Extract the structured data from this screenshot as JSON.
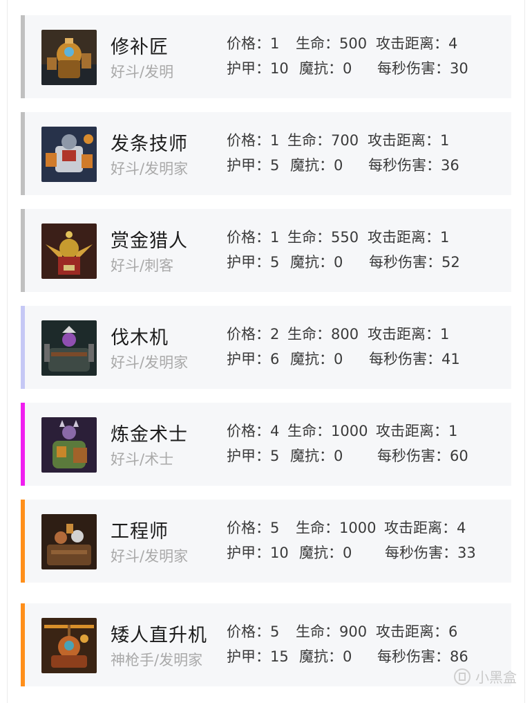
{
  "labels": {
    "price": "价格：",
    "hp": "生命：",
    "range": "攻击距离：",
    "armor": "护甲：",
    "mr": "魔抗：",
    "dps": "每秒伤害："
  },
  "units": [
    {
      "name": "修补匠",
      "traits": "好斗/发明",
      "price": "1",
      "hp": "500",
      "range": "4",
      "armor": "10",
      "mr": "0",
      "dps": "30",
      "accent": "#c0c0c0",
      "portrait": "tinker-portrait"
    },
    {
      "name": "发条技师",
      "traits": "好斗/发明家",
      "price": "1",
      "hp": "700",
      "range": "1",
      "armor": "5",
      "mr": "0",
      "dps": "36",
      "accent": "#c0c0c0",
      "portrait": "clockwerk-portrait"
    },
    {
      "name": "赏金猎人",
      "traits": "好斗/刺客",
      "price": "1",
      "hp": "550",
      "range": "1",
      "armor": "5",
      "mr": "0",
      "dps": "52",
      "accent": "#c0c0c0",
      "portrait": "bounty-hunter-portrait"
    },
    {
      "name": "伐木机",
      "traits": "好斗/发明家",
      "price": "2",
      "hp": "800",
      "range": "1",
      "armor": "6",
      "mr": "0",
      "dps": "41",
      "accent": "#c5c8f5",
      "portrait": "timbersaw-portrait"
    },
    {
      "name": "炼金术士",
      "traits": "好斗/术士",
      "price": "4",
      "hp": "1000",
      "range": "1",
      "armor": "5",
      "mr": "0",
      "dps": "60",
      "accent": "#f01ef0",
      "portrait": "alchemist-portrait"
    },
    {
      "name": "工程师",
      "traits": "好斗/发明家",
      "price": "5",
      "hp": "1000",
      "range": "4",
      "armor": "10",
      "mr": "0",
      "dps": "33",
      "accent": "#ff8f1a",
      "portrait": "techies-portrait"
    },
    {
      "name": "矮人直升机",
      "traits": "神枪手/发明家",
      "price": "5",
      "hp": "900",
      "range": "6",
      "armor": "15",
      "mr": "0",
      "dps": "86",
      "accent": "#ff8f1a",
      "portrait": "gyrocopter-portrait"
    }
  ],
  "watermark": {
    "text": "小黑盒",
    "icon": "xiaoheihe-logo-icon"
  }
}
